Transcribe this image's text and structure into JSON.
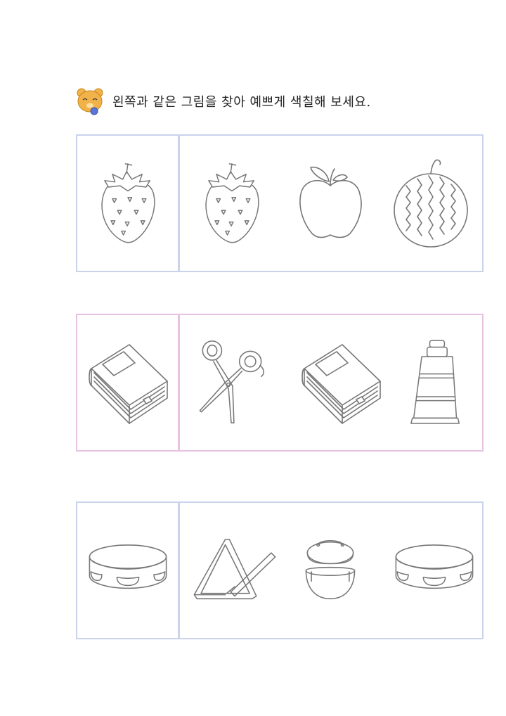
{
  "instruction": "왼쪽과 같은 그림을 찾아 예쁘게 색칠해 보세요.",
  "mascot_icon": "bear-icon",
  "rows": [
    {
      "border_color": "#c9d3ea",
      "target": "strawberry",
      "options": [
        "strawberry",
        "apple",
        "watermelon"
      ]
    },
    {
      "border_color": "#e8c3e1",
      "target": "book",
      "options": [
        "scissors",
        "book",
        "paint-tube"
      ]
    },
    {
      "border_color": "#c9d3ea",
      "target": "tambourine",
      "options": [
        "triangle",
        "castanets",
        "tambourine"
      ]
    }
  ]
}
